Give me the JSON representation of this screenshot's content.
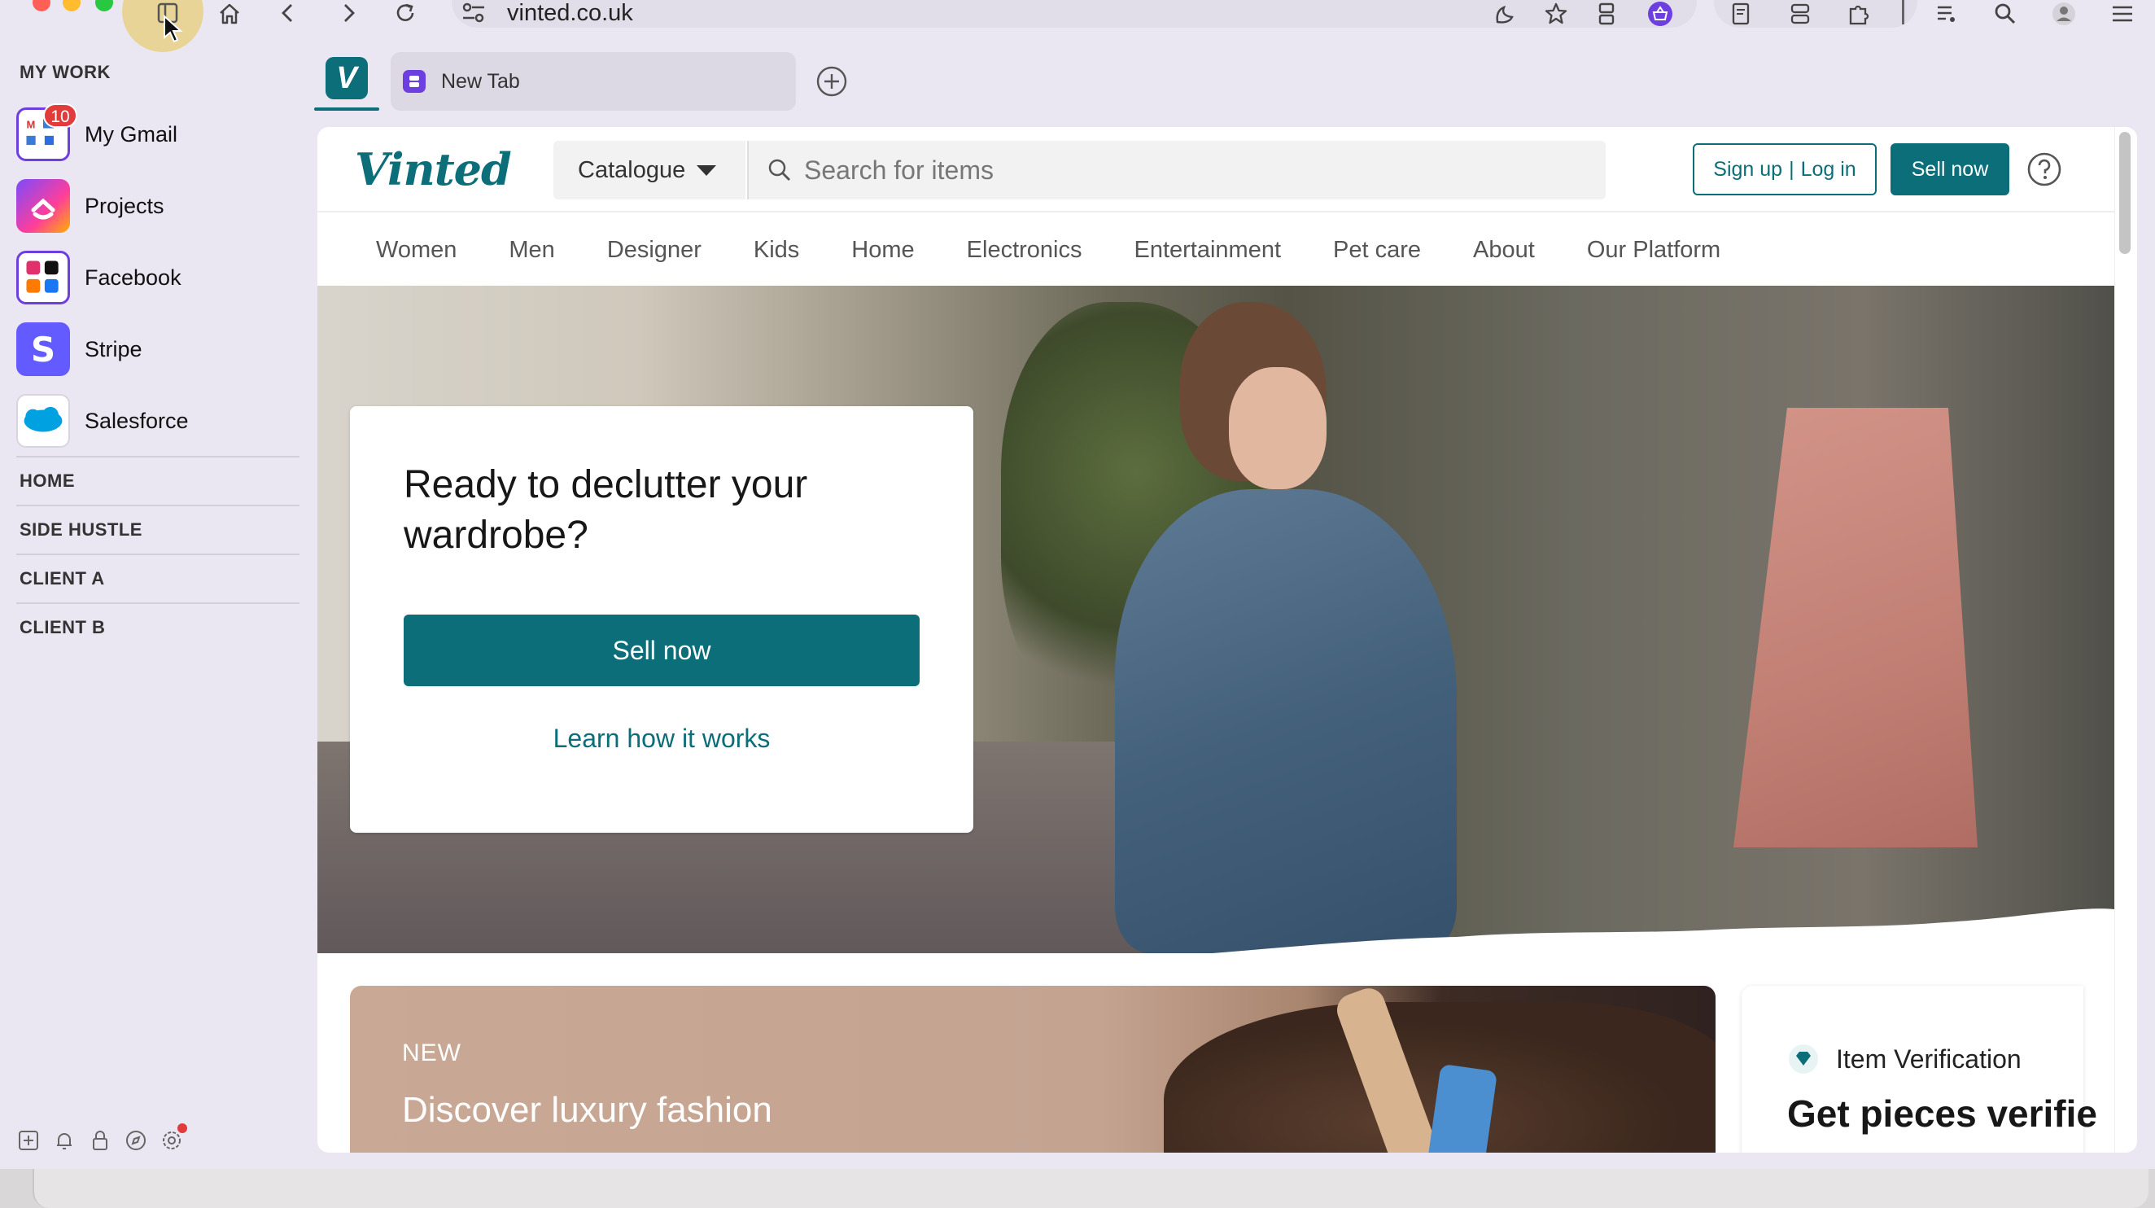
{
  "browser": {
    "url": "vinted.co.uk",
    "tabs": [
      {
        "label": "V",
        "active": true
      },
      {
        "label": "New Tab",
        "active": false
      }
    ]
  },
  "sidebar": {
    "my_work_title": "MY WORK",
    "apps": [
      {
        "label": "My Gmail",
        "badge": "10",
        "icon": "gmail-workspace-icon"
      },
      {
        "label": "Projects",
        "icon": "clickup-icon"
      },
      {
        "label": "Facebook",
        "icon": "social-apps-icon"
      },
      {
        "label": "Stripe",
        "icon": "stripe-icon"
      },
      {
        "label": "Salesforce",
        "icon": "salesforce-icon"
      }
    ],
    "sections": [
      "HOME",
      "SIDE HUSTLE",
      "CLIENT A",
      "CLIENT B"
    ]
  },
  "vinted": {
    "logo": "Vinted",
    "catalogue_label": "Catalogue",
    "search_placeholder": "Search for items",
    "signup_label": "Sign up",
    "login_label": "Log in",
    "sell_now_label": "Sell now",
    "nav": [
      "Women",
      "Men",
      "Designer",
      "Kids",
      "Home",
      "Electronics",
      "Entertainment",
      "Pet care",
      "About",
      "Our Platform"
    ],
    "hero": {
      "title": "Ready to declutter your wardrobe?",
      "button": "Sell now",
      "link": "Learn how it works"
    },
    "luxury": {
      "eyebrow": "NEW",
      "title": "Discover luxury fashion"
    },
    "verification": {
      "label": "Item Verification",
      "title": "Get pieces verifie"
    }
  },
  "colors": {
    "brand": "#0b6e79",
    "badge": "#e23b3b",
    "sidebar_bg": "#ebe7f2"
  }
}
